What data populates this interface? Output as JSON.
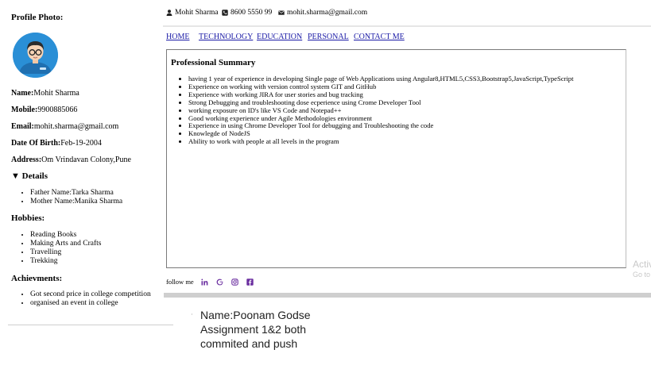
{
  "sidebar": {
    "profile_photo_label": "Profile Photo:",
    "name_label": "Name:",
    "name_value": "Mohit Sharma",
    "mobile_label": "Mobile:",
    "mobile_value": "9900885066",
    "email_label": "Email:",
    "email_value": "mohit.sharma@gmail.com",
    "dob_label": "Date Of Birth:",
    "dob_value": "Feb-19-2004",
    "address_label": "Address:",
    "address_value": "Om Vrindavan Colony,Pune",
    "details_toggle": "▼ Details",
    "details": [
      "Father Name:Tarka Sharma",
      "Mother Name:Manika Sharma"
    ],
    "hobbies_title": "Hobbies:",
    "hobbies": [
      "Reading Books",
      "Making Arts and Crafts",
      "Travelling",
      "Trekking"
    ],
    "achievements_title": "Achievments:",
    "achievements": [
      "Got second price in college competition",
      "organised an event in college"
    ]
  },
  "header": {
    "name": "Mohit Sharma",
    "phone": "8600 5550 99",
    "email": "mohit.sharma@gmail.com",
    "icons": [
      "user-icon",
      "phone-icon",
      "envelope-icon"
    ]
  },
  "nav": {
    "items": [
      "HOME",
      "TECHNOLOGY",
      "EDUCATION",
      "PERSONAL",
      "CONTACT ME"
    ],
    "link_color": "#1a1aa6"
  },
  "summary": {
    "title": "Professional Summary",
    "items": [
      "having 1 year of experience in developing Single page of Web Applications using Angular8,HTML5,CSS3,Bootstrap5,JavaScript,TypeScript",
      "Experience on working with version control system  GIT and GitHub",
      "Experience with working JIRA for user stories and bug tracking",
      "Strong Debugging and troubleshooting dose ecperience using Crome Developer Tool",
      "working exposure on ID's like VS Code and Notepad++",
      "Good working experience under Agile Methodologies environment",
      "Experience in using Chrome Developer Tool for debugging and Troubleshooting the code",
      "Knowlegde of NodeJS",
      "Ability to work with people at all levels in the program"
    ]
  },
  "footer": {
    "follow_label": "follow me",
    "social_icons": [
      "linkedin-icon",
      "google-icon",
      "instagram-icon",
      "facebook-icon"
    ],
    "icon_color": "#6b2fa0"
  },
  "note": {
    "lines": [
      "Name:Poonam Godse",
      "Assignment 1&2 both",
      "commited and push"
    ]
  },
  "watermark": {
    "line1": "Activ",
    "line2": "Go to"
  }
}
